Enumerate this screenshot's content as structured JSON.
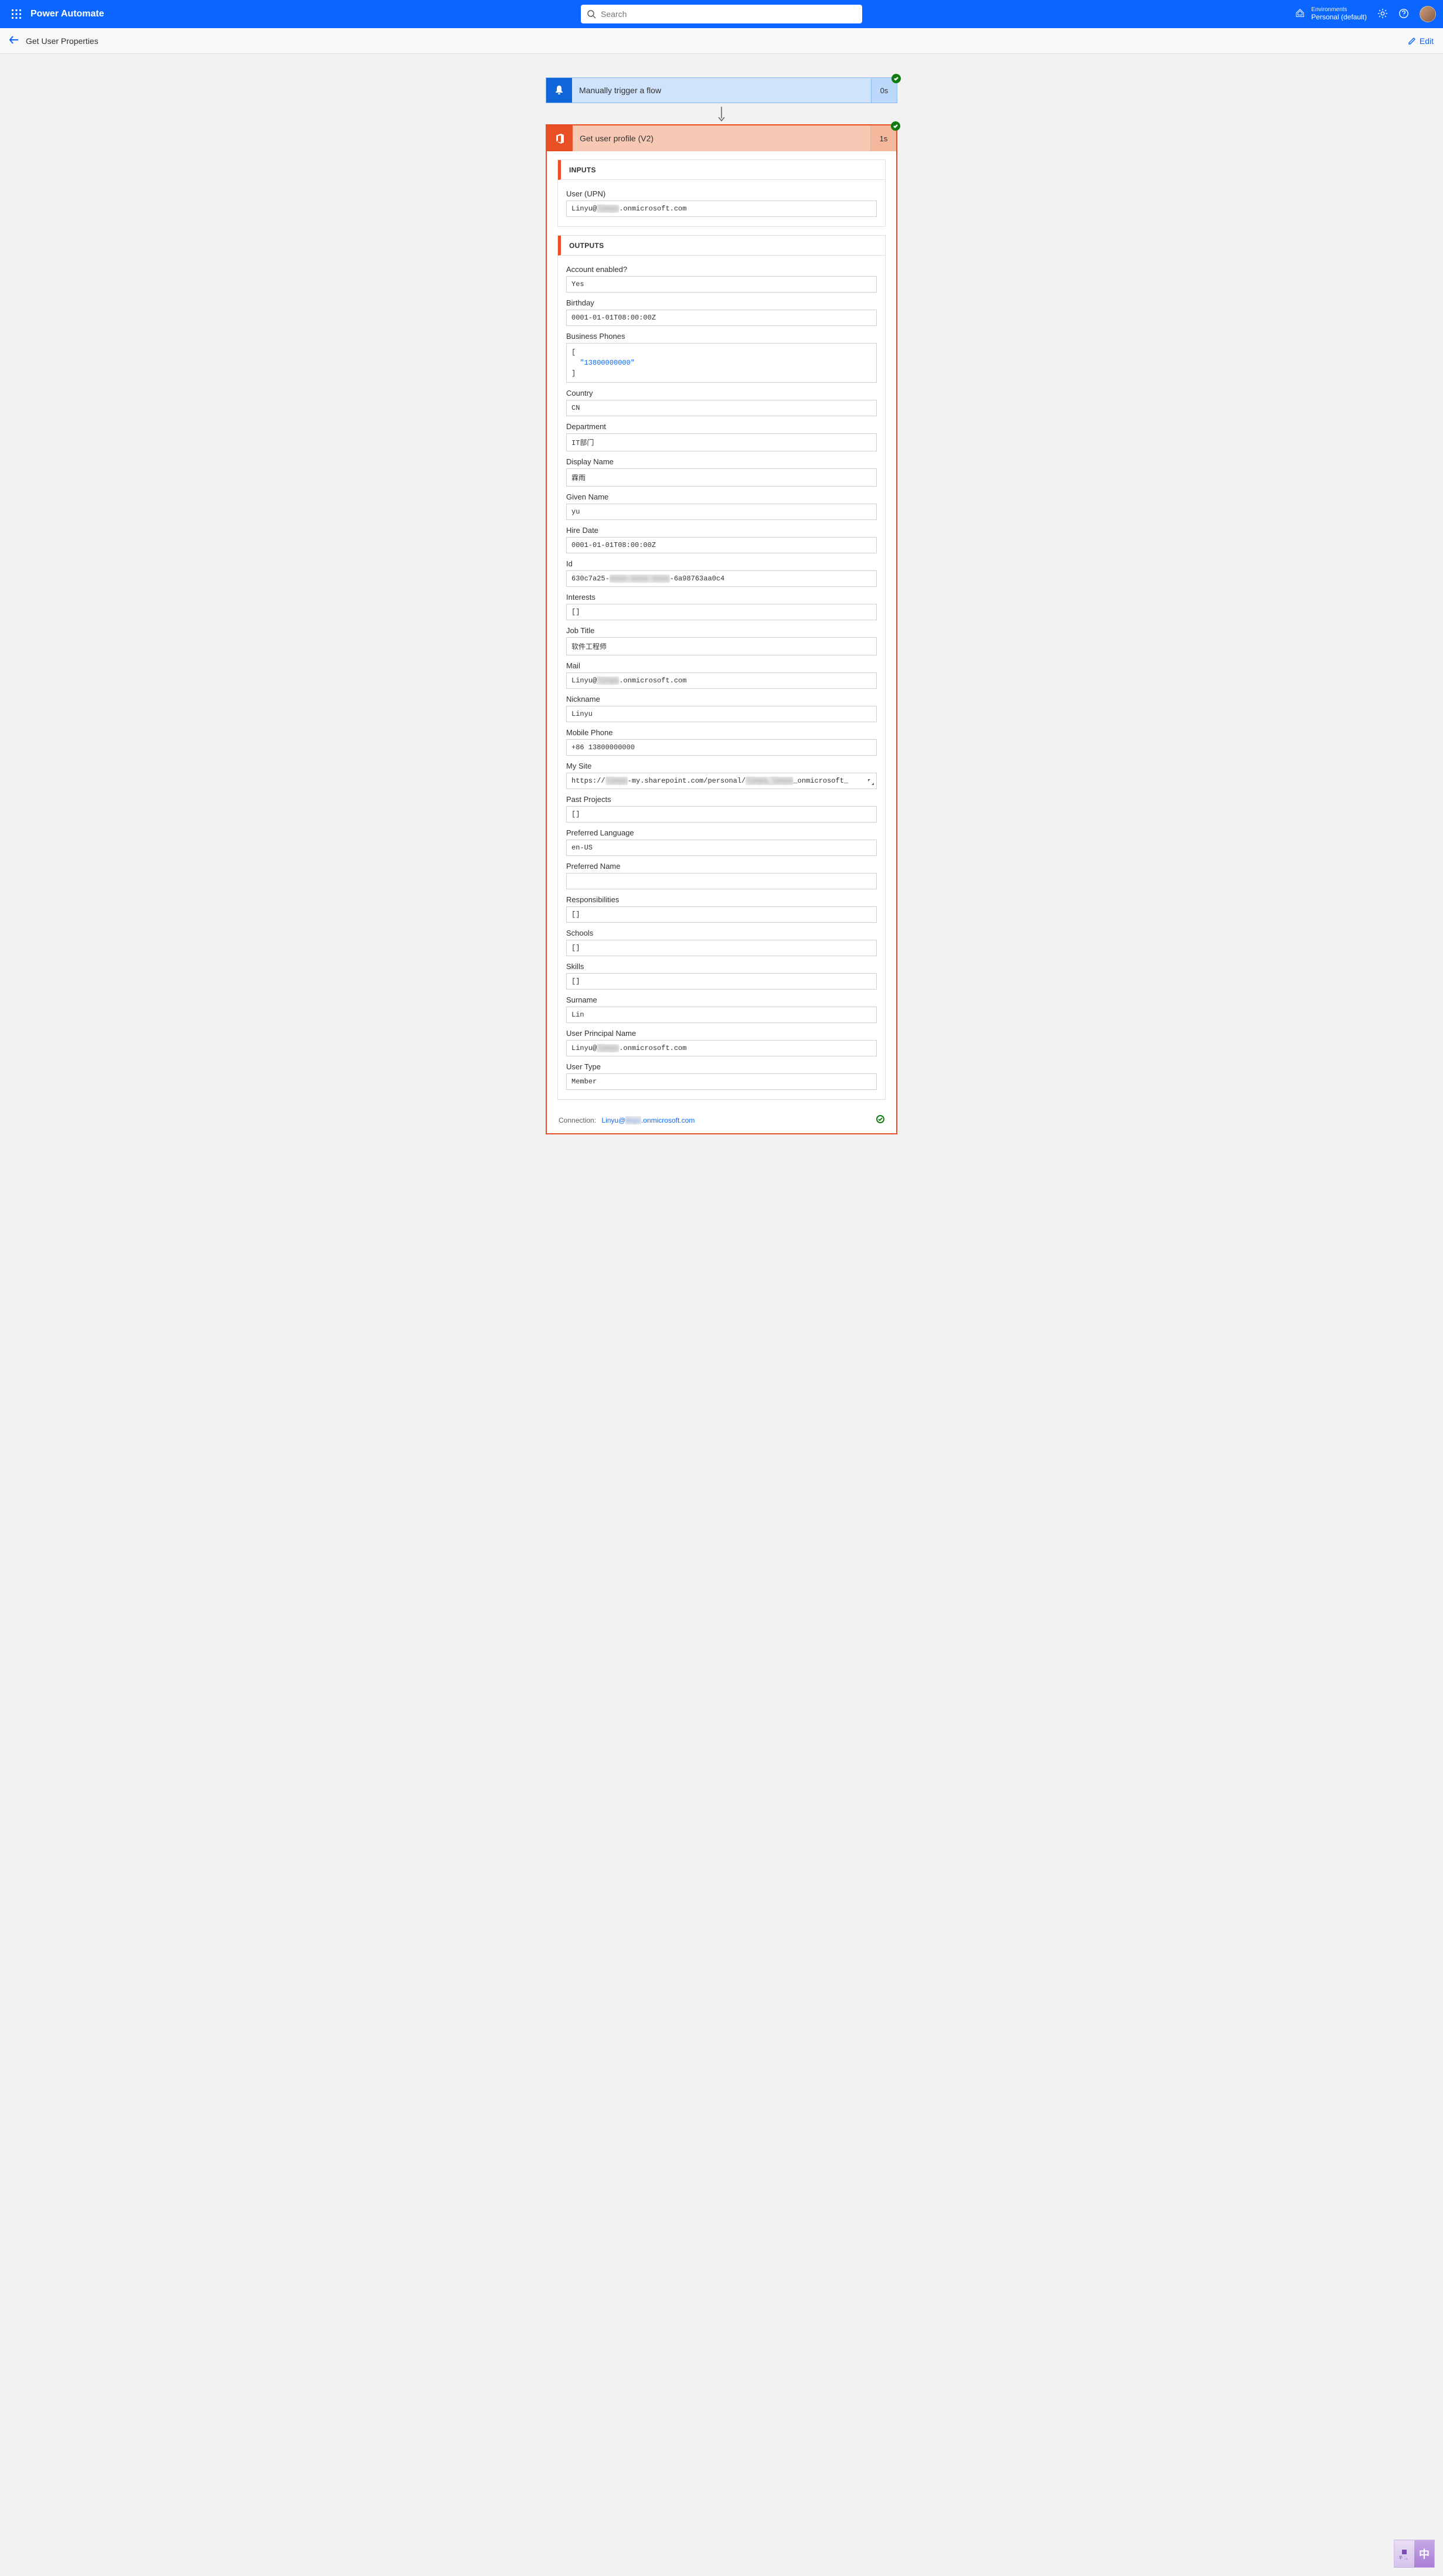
{
  "topbar": {
    "app_title": "Power Automate",
    "search_placeholder": "Search",
    "environments_label": "Environments",
    "environment_name": "Personal (default)"
  },
  "subheader": {
    "page_title": "Get User Properties",
    "edit_label": "Edit"
  },
  "trigger": {
    "title": "Manually trigger a flow",
    "duration": "0s"
  },
  "action": {
    "title": "Get user profile (V2)",
    "duration": "1s",
    "inputs_label": "INPUTS",
    "outputs_label": "OUTPUTS",
    "inputs": {
      "user_upn_label": "User (UPN)",
      "user_upn_prefix": "Linyu@",
      "user_upn_blur": "linyu",
      "user_upn_suffix": ".onmicrosoft.com"
    },
    "outputs": {
      "account_enabled_label": "Account enabled?",
      "account_enabled_value": "Yes",
      "birthday_label": "Birthday",
      "birthday_value": "0001-01-01T08:00:00Z",
      "business_phones_label": "Business Phones",
      "business_phones_json": "\"13800000000\"",
      "country_label": "Country",
      "country_value": "CN",
      "department_label": "Department",
      "department_value": "IT部门",
      "display_name_label": "Display Name",
      "display_name_value": "霖雨",
      "given_name_label": "Given Name",
      "given_name_value": "yu",
      "hire_date_label": "Hire Date",
      "hire_date_value": "0001-01-01T08:00:00Z",
      "id_label": "Id",
      "id_prefix": "630c7a25-",
      "id_blur": "xxxx-xxxx-xxxx",
      "id_suffix": "-6a98763aa0c4",
      "interests_label": "Interests",
      "interests_value": "[]",
      "job_title_label": "Job Title",
      "job_title_value": "软件工程师",
      "mail_label": "Mail",
      "mail_prefix": "Linyu@",
      "mail_blur": "linyu",
      "mail_suffix": ".onmicrosoft.com",
      "nickname_label": "Nickname",
      "nickname_value": "Linyu",
      "mobile_phone_label": "Mobile Phone",
      "mobile_phone_value": "+86 13800000000",
      "my_site_label": "My Site",
      "my_site_prefix": "https://",
      "my_site_blur1": "linyu",
      "my_site_mid": "-my.sharepoint.com/personal/",
      "my_site_blur2": "linyu_linyu",
      "my_site_suffix": "_onmicrosoft_",
      "past_projects_label": "Past Projects",
      "past_projects_value": "[]",
      "preferred_language_label": "Preferred Language",
      "preferred_language_value": "en-US",
      "preferred_name_label": "Preferred Name",
      "preferred_name_value": "",
      "responsibilities_label": "Responsibilities",
      "responsibilities_value": "[]",
      "schools_label": "Schools",
      "schools_value": "[]",
      "skills_label": "Skills",
      "skills_value": "[]",
      "surname_label": "Surname",
      "surname_value": "Lin",
      "upn_label": "User Principal Name",
      "upn_prefix": "Linyu@",
      "upn_blur": "linyu",
      "upn_suffix": ".onmicrosoft.com",
      "user_type_label": "User Type",
      "user_type_value": "Member"
    },
    "connection_label": "Connection:",
    "connection_prefix": "Linyu@",
    "connection_blur": "linyu",
    "connection_suffix": ".onmicrosoft.com"
  },
  "ime": {
    "small": "半 ：。",
    "big": "中"
  }
}
